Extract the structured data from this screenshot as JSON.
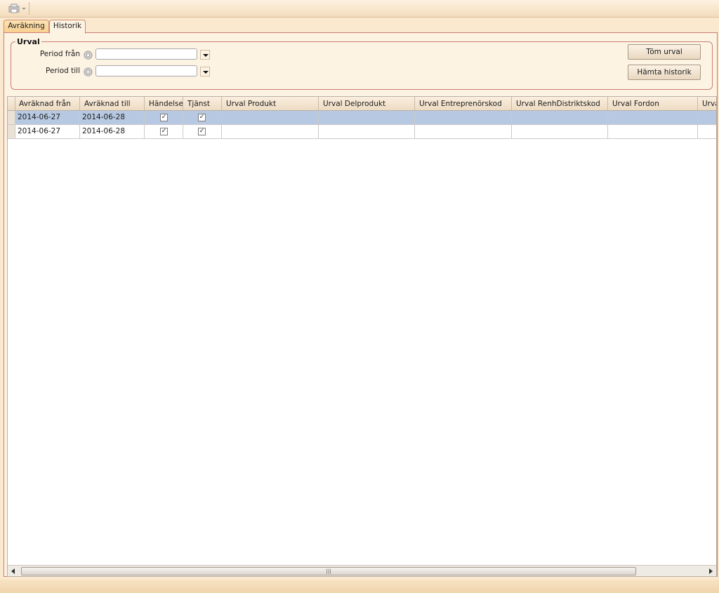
{
  "tabs": [
    {
      "label": "Avräkning",
      "active": false
    },
    {
      "label": "Historik",
      "active": true
    }
  ],
  "urval": {
    "legend": "Urval",
    "period_fran_label": "Period från",
    "period_fran_value": "",
    "period_till_label": "Period till",
    "period_till_value": "",
    "tom_urval_label": "Töm urval",
    "hamta_historik_label": "Hämta historik"
  },
  "grid": {
    "columns": [
      "Avräknad från",
      "Avräknad till",
      "Händelse",
      "Tjänst",
      "Urval Produkt",
      "Urval Delprodukt",
      "Urval Entreprenörskod",
      "Urval RenhDistriktskod",
      "Urval Fordon",
      "Urva"
    ],
    "rows": [
      {
        "from": "2014-06-27",
        "to": "2014-06-28",
        "handelse": true,
        "tjanst": true,
        "produkt": "",
        "delprodukt": "",
        "entreprenorskod": "",
        "renhdistriktskod": "",
        "fordon": "",
        "extra": "",
        "selected": true
      },
      {
        "from": "2014-06-27",
        "to": "2014-06-28",
        "handelse": true,
        "tjanst": true,
        "produkt": "",
        "delprodukt": "",
        "entreprenorskod": "",
        "renhdistriktskod": "",
        "fordon": "",
        "extra": "",
        "selected": false
      }
    ]
  },
  "icons": {
    "toolbar": "printer-dropdown-icon",
    "calendar": "gear-icon",
    "dropdown": "chevron-down-icon",
    "check": "✓",
    "scroll_grip": "|||"
  },
  "colors": {
    "selected_row": "#b7c9e2",
    "panel_border": "#c97f73",
    "background": "#fbe9cf"
  }
}
